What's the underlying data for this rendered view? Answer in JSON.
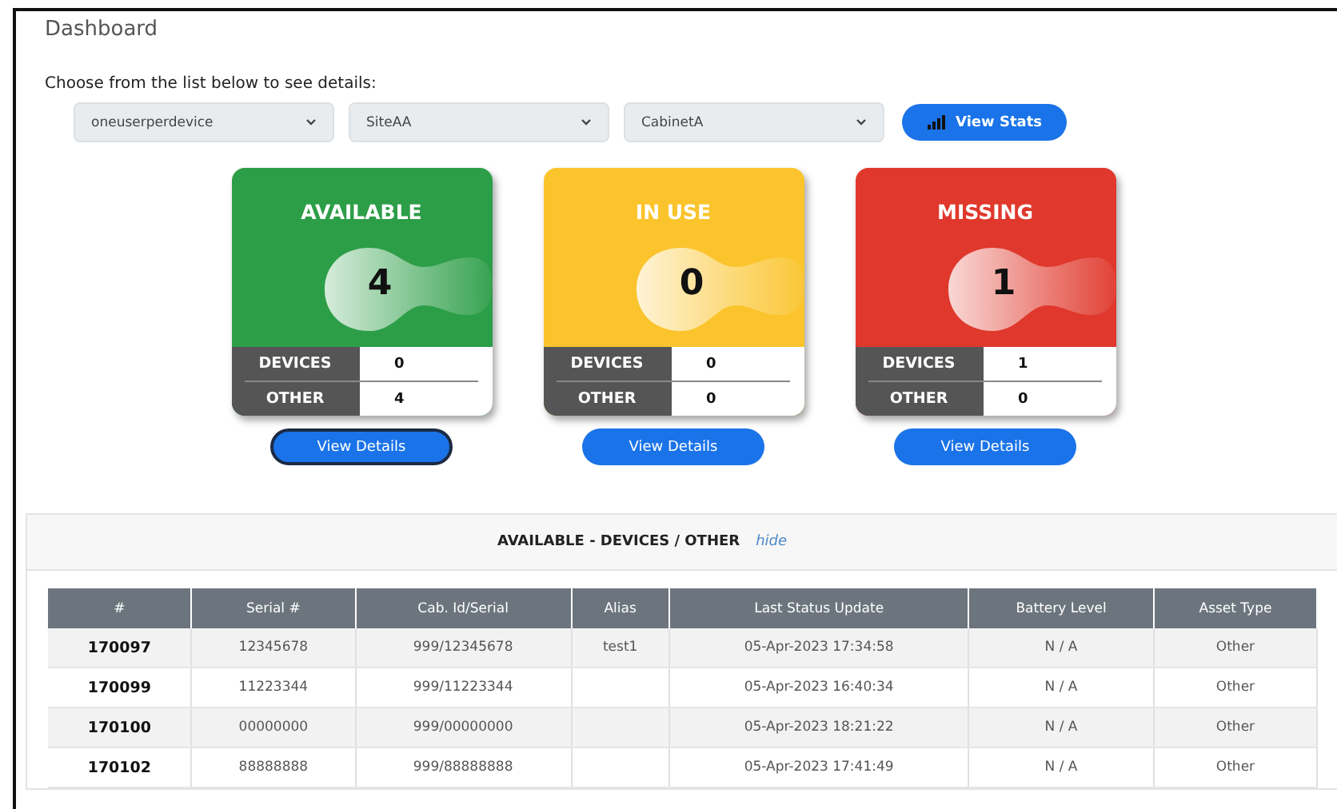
{
  "page": {
    "title": "Dashboard"
  },
  "filters": {
    "prompt": "Choose from the list below to see details:",
    "selects": [
      {
        "value": "oneuserperdevice"
      },
      {
        "value": "SiteAA"
      },
      {
        "value": "CabinetA"
      }
    ],
    "button": "View Stats"
  },
  "cards": [
    {
      "kind": "available",
      "title": "AVAILABLE",
      "count": "4",
      "rows": [
        {
          "label": "DEVICES",
          "value": "0"
        },
        {
          "label": "OTHER",
          "value": "4"
        }
      ],
      "button": {
        "label": "View Details",
        "focused": true
      }
    },
    {
      "kind": "in_use",
      "title": "IN USE",
      "count": "0",
      "rows": [
        {
          "label": "DEVICES",
          "value": "0"
        },
        {
          "label": "OTHER",
          "value": "0"
        }
      ],
      "button": {
        "label": "View Details",
        "focused": false
      }
    },
    {
      "kind": "missing",
      "title": "MISSING",
      "count": "1",
      "rows": [
        {
          "label": "DEVICES",
          "value": "1"
        },
        {
          "label": "OTHER",
          "value": "0"
        }
      ],
      "button": {
        "label": "View Details",
        "focused": false
      }
    }
  ],
  "details": {
    "title": "AVAILABLE - DEVICES / OTHER",
    "toggle": "hide",
    "columns": [
      "#",
      "Serial #",
      "Cab. Id/Serial",
      "Alias",
      "Last Status Update",
      "Battery Level",
      "Asset Type"
    ],
    "rows": [
      [
        "170097",
        "12345678",
        "999/12345678",
        "test1",
        "05-Apr-2023 17:34:58",
        "N / A",
        "Other"
      ],
      [
        "170099",
        "11223344",
        "999/11223344",
        "",
        "05-Apr-2023 16:40:34",
        "N / A",
        "Other"
      ],
      [
        "170100",
        "00000000",
        "999/00000000",
        "",
        "05-Apr-2023 18:21:22",
        "N / A",
        "Other"
      ],
      [
        "170102",
        "88888888",
        "999/88888888",
        "",
        "05-Apr-2023 17:41:49",
        "N / A",
        "Other"
      ]
    ]
  }
}
